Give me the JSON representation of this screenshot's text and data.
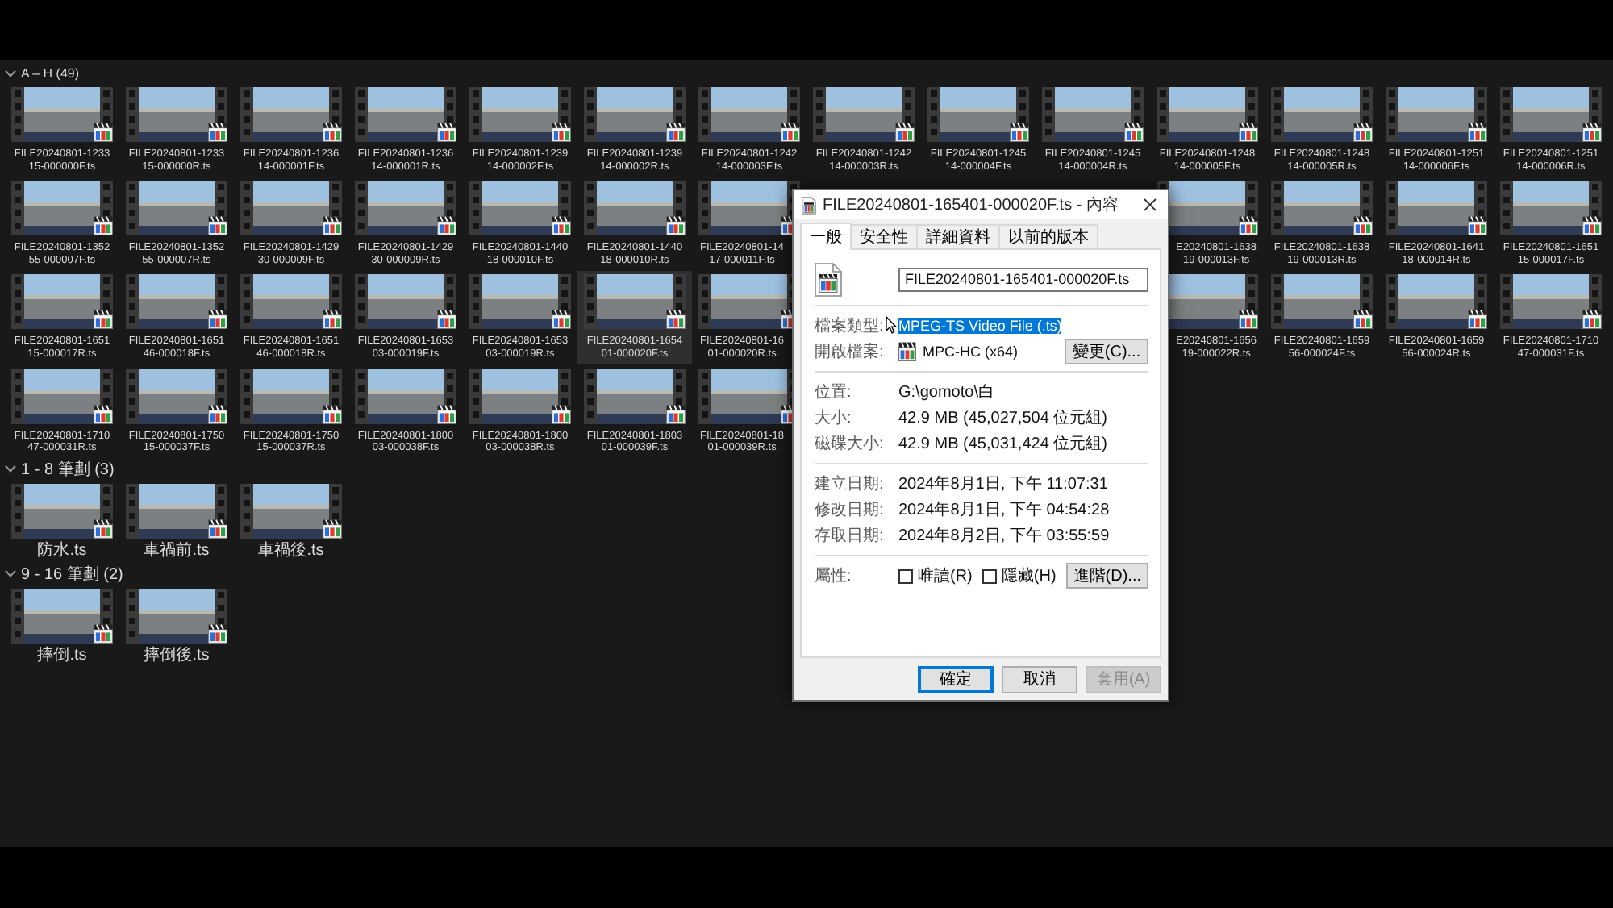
{
  "explorer": {
    "groups": [
      {
        "title": "A – H (49)",
        "expanded": true,
        "items": [
          {
            "kind": "video",
            "lines": [
              "FILE20240801-1233",
              "15-000000F.ts"
            ],
            "selected": false
          },
          {
            "kind": "video",
            "lines": [
              "FILE20240801-1233",
              "15-000000R.ts"
            ],
            "selected": false
          },
          {
            "kind": "video",
            "lines": [
              "FILE20240801-1236",
              "14-000001F.ts"
            ],
            "selected": false
          },
          {
            "kind": "video",
            "lines": [
              "FILE20240801-1236",
              "14-000001R.ts"
            ],
            "selected": false
          },
          {
            "kind": "video",
            "lines": [
              "FILE20240801-1239",
              "14-000002F.ts"
            ],
            "selected": false
          },
          {
            "kind": "video",
            "lines": [
              "FILE20240801-1239",
              "14-000002R.ts"
            ],
            "selected": false
          },
          {
            "kind": "video",
            "lines": [
              "FILE20240801-1242",
              "14-000003F.ts"
            ],
            "selected": false
          },
          {
            "kind": "video",
            "lines": [
              "FILE20240801-1242",
              "14-000003R.ts"
            ],
            "selected": false
          },
          {
            "kind": "video",
            "lines": [
              "FILE20240801-1245",
              "14-000004F.ts"
            ],
            "selected": false
          },
          {
            "kind": "video",
            "lines": [
              "FILE20240801-1245",
              "14-000004R.ts"
            ],
            "selected": false
          },
          {
            "kind": "video",
            "lines": [
              "FILE20240801-1248",
              "14-000005F.ts"
            ],
            "selected": false
          },
          {
            "kind": "video",
            "lines": [
              "FILE20240801-1248",
              "14-000005R.ts"
            ],
            "selected": false
          },
          {
            "kind": "video",
            "lines": [
              "FILE20240801-1251",
              "14-000006F.ts"
            ],
            "selected": false
          },
          {
            "kind": "video",
            "lines": [
              "FILE20240801-1251",
              "14-000006R.ts"
            ],
            "selected": false
          },
          {
            "kind": "video",
            "lines": [
              "FILE20240801-1352",
              "55-000007F.ts"
            ],
            "selected": false
          },
          {
            "kind": "video",
            "lines": [
              "FILE20240801-1352",
              "55-000007R.ts"
            ],
            "selected": false
          },
          {
            "kind": "video",
            "lines": [
              "FILE20240801-1429",
              "30-000009F.ts"
            ],
            "selected": false
          },
          {
            "kind": "video",
            "lines": [
              "FILE20240801-1429",
              "30-000009R.ts"
            ],
            "selected": false
          },
          {
            "kind": "video",
            "lines": [
              "FILE20240801-1440",
              "18-000010F.ts"
            ],
            "selected": false
          },
          {
            "kind": "video",
            "lines": [
              "FILE20240801-1440",
              "18-000010R.ts"
            ],
            "selected": false
          },
          {
            "kind": "cut_right",
            "lines": [
              "FILE20240801-14",
              "17-000011F.ts"
            ],
            "selected": false
          },
          {
            "kind": "covered"
          },
          {
            "kind": "covered"
          },
          {
            "kind": "covered"
          },
          {
            "kind": "cut_left",
            "lines": [
              "E20240801-1638",
              "19-000013F.ts"
            ],
            "selected": false
          },
          {
            "kind": "video",
            "lines": [
              "FILE20240801-1638",
              "19-000013R.ts"
            ],
            "selected": false
          },
          {
            "kind": "video",
            "lines": [
              "FILE20240801-1641",
              "18-000014R.ts"
            ],
            "selected": false
          },
          {
            "kind": "video",
            "lines": [
              "FILE20240801-1651",
              "15-000017F.ts"
            ],
            "selected": false
          },
          {
            "kind": "video",
            "lines": [
              "FILE20240801-1651",
              "15-000017R.ts"
            ],
            "selected": false
          },
          {
            "kind": "video",
            "lines": [
              "FILE20240801-1651",
              "46-000018F.ts"
            ],
            "selected": false
          },
          {
            "kind": "video",
            "lines": [
              "FILE20240801-1651",
              "46-000018R.ts"
            ],
            "selected": false
          },
          {
            "kind": "video",
            "lines": [
              "FILE20240801-1653",
              "03-000019F.ts"
            ],
            "selected": false
          },
          {
            "kind": "video",
            "lines": [
              "FILE20240801-1653",
              "03-000019R.ts"
            ],
            "selected": false
          },
          {
            "kind": "video",
            "lines": [
              "FILE20240801-1654",
              "01-000020F.ts"
            ],
            "selected": true
          },
          {
            "kind": "cut_right",
            "lines": [
              "FILE20240801-16",
              "01-000020R.ts"
            ],
            "selected": false
          },
          {
            "kind": "covered"
          },
          {
            "kind": "covered"
          },
          {
            "kind": "covered"
          },
          {
            "kind": "cut_left",
            "lines": [
              "E20240801-1656",
              "19-000022R.ts"
            ],
            "selected": false
          },
          {
            "kind": "video",
            "lines": [
              "FILE20240801-1659",
              "56-000024F.ts"
            ],
            "selected": false
          },
          {
            "kind": "video",
            "lines": [
              "FILE20240801-1659",
              "56-000024R.ts"
            ],
            "selected": false
          },
          {
            "kind": "video",
            "lines": [
              "FILE20240801-1710",
              "47-000031F.ts"
            ],
            "selected": false
          },
          {
            "kind": "video",
            "lines": [
              "FILE20240801-1710",
              "47-000031R.ts"
            ],
            "selected": false
          },
          {
            "kind": "video",
            "lines": [
              "FILE20240801-1750",
              "15-000037F.ts"
            ],
            "selected": false
          },
          {
            "kind": "video",
            "lines": [
              "FILE20240801-1750",
              "15-000037R.ts"
            ],
            "selected": false
          },
          {
            "kind": "video",
            "lines": [
              "FILE20240801-1800",
              "03-000038F.ts"
            ],
            "selected": false
          },
          {
            "kind": "video",
            "lines": [
              "FILE20240801-1800",
              "03-000038R.ts"
            ],
            "selected": false
          },
          {
            "kind": "video",
            "lines": [
              "FILE20240801-1803",
              "01-000039F.ts"
            ],
            "selected": false
          },
          {
            "kind": "cut_right",
            "lines": [
              "FILE20240801-18",
              "01-000039R.ts"
            ],
            "selected": false
          }
        ]
      },
      {
        "title": "1 - 8 筆劃 (3)",
        "expanded": true,
        "items": [
          {
            "kind": "video",
            "lines": [
              "防水.ts"
            ],
            "selected": false
          },
          {
            "kind": "video",
            "lines": [
              "車禍前.ts"
            ],
            "selected": false
          },
          {
            "kind": "video",
            "lines": [
              "車禍後.ts"
            ],
            "selected": false
          }
        ]
      },
      {
        "title": "9 - 16 筆劃 (2)",
        "expanded": true,
        "items": [
          {
            "kind": "video",
            "lines": [
              "摔倒.ts"
            ],
            "selected": false
          },
          {
            "kind": "video",
            "lines": [
              "摔倒後.ts"
            ],
            "selected": false
          }
        ]
      }
    ]
  },
  "dialog": {
    "title": "FILE20240801-165401-000020F.ts - 內容",
    "tabs": [
      {
        "label": "一般",
        "selected": true
      },
      {
        "label": "安全性",
        "selected": false
      },
      {
        "label": "詳細資料",
        "selected": false
      },
      {
        "label": "以前的版本",
        "selected": false
      }
    ],
    "file_name": "FILE20240801-165401-000020F.ts",
    "sections": [
      [
        {
          "kind": "text",
          "label": "檔案類型:",
          "value": "MPEG-TS Video File (.ts)",
          "highlighted": true
        },
        {
          "kind": "app",
          "label": "開啟檔案:",
          "value": "MPC-HC (x64)",
          "highlighted": false,
          "button": "變更(C)..."
        }
      ],
      [
        {
          "kind": "text",
          "label": "位置:",
          "value": "G:\\gomoto\\白",
          "highlighted": false
        },
        {
          "kind": "text",
          "label": "大小:",
          "value": "42.9 MB (45,027,504 位元組)",
          "highlighted": false
        },
        {
          "kind": "text",
          "label": "磁碟大小:",
          "value": "42.9 MB (45,031,424 位元組)",
          "highlighted": false
        }
      ],
      [
        {
          "kind": "text",
          "label": "建立日期:",
          "value": "2024年8月1日, 下午 11:07:31",
          "highlighted": false
        },
        {
          "kind": "text",
          "label": "修改日期:",
          "value": "2024年8月1日, 下午 04:54:28",
          "highlighted": false
        },
        {
          "kind": "text",
          "label": "存取日期:",
          "value": "2024年8月2日, 下午 03:55:59",
          "highlighted": false
        }
      ]
    ],
    "attributes": {
      "label": "屬性:",
      "checkboxes": [
        {
          "label": "唯讀(R)",
          "checked": false
        },
        {
          "label": "隱藏(H)",
          "checked": false
        }
      ],
      "button": "進階(D)..."
    },
    "buttons": [
      {
        "label": "確定",
        "default": true,
        "disabled": false
      },
      {
        "label": "取消",
        "default": false,
        "disabled": false
      },
      {
        "label": "套用(A)",
        "default": false,
        "disabled": true
      }
    ]
  }
}
